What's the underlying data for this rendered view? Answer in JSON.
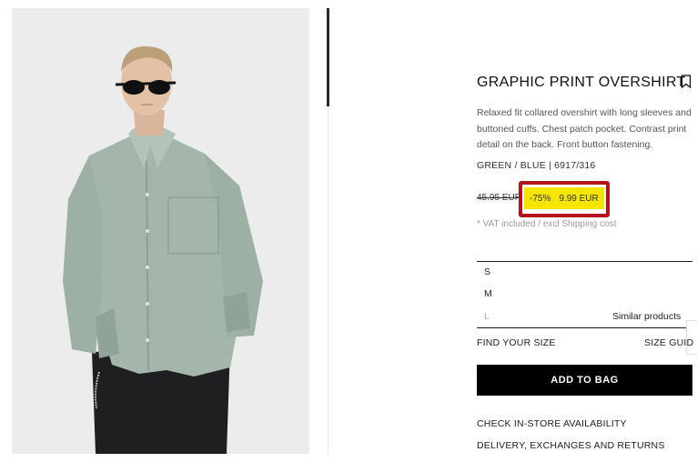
{
  "product": {
    "title": "GRAPHIC PRINT OVERSHIRT",
    "description": "Relaxed fit collared overshirt with long sleeves and buttoned cuffs. Chest patch pocket. Contrast print detail on the back. Front button fastening.",
    "color_ref": "GREEN / BLUE | 6917/316",
    "old_price": "45.95 EUR",
    "discount": "-75%",
    "new_price": "9.99 EUR",
    "vat_note": "* VAT included / excl Shipping cost"
  },
  "sizes": {
    "options": [
      "S",
      "M",
      "L"
    ],
    "similar_label": "Similar products",
    "find_label": "FIND YOUR SIZE",
    "guide_label": "SIZE GUID"
  },
  "actions": {
    "add_to_bag": "ADD TO BAG",
    "check_store": "CHECK IN-STORE AVAILABILITY",
    "delivery": "DELIVERY, EXCHANGES AND RETURNS"
  },
  "colors": {
    "highlight": "#f5e500",
    "annotation_border": "#b3141b",
    "button_bg": "#000000"
  }
}
